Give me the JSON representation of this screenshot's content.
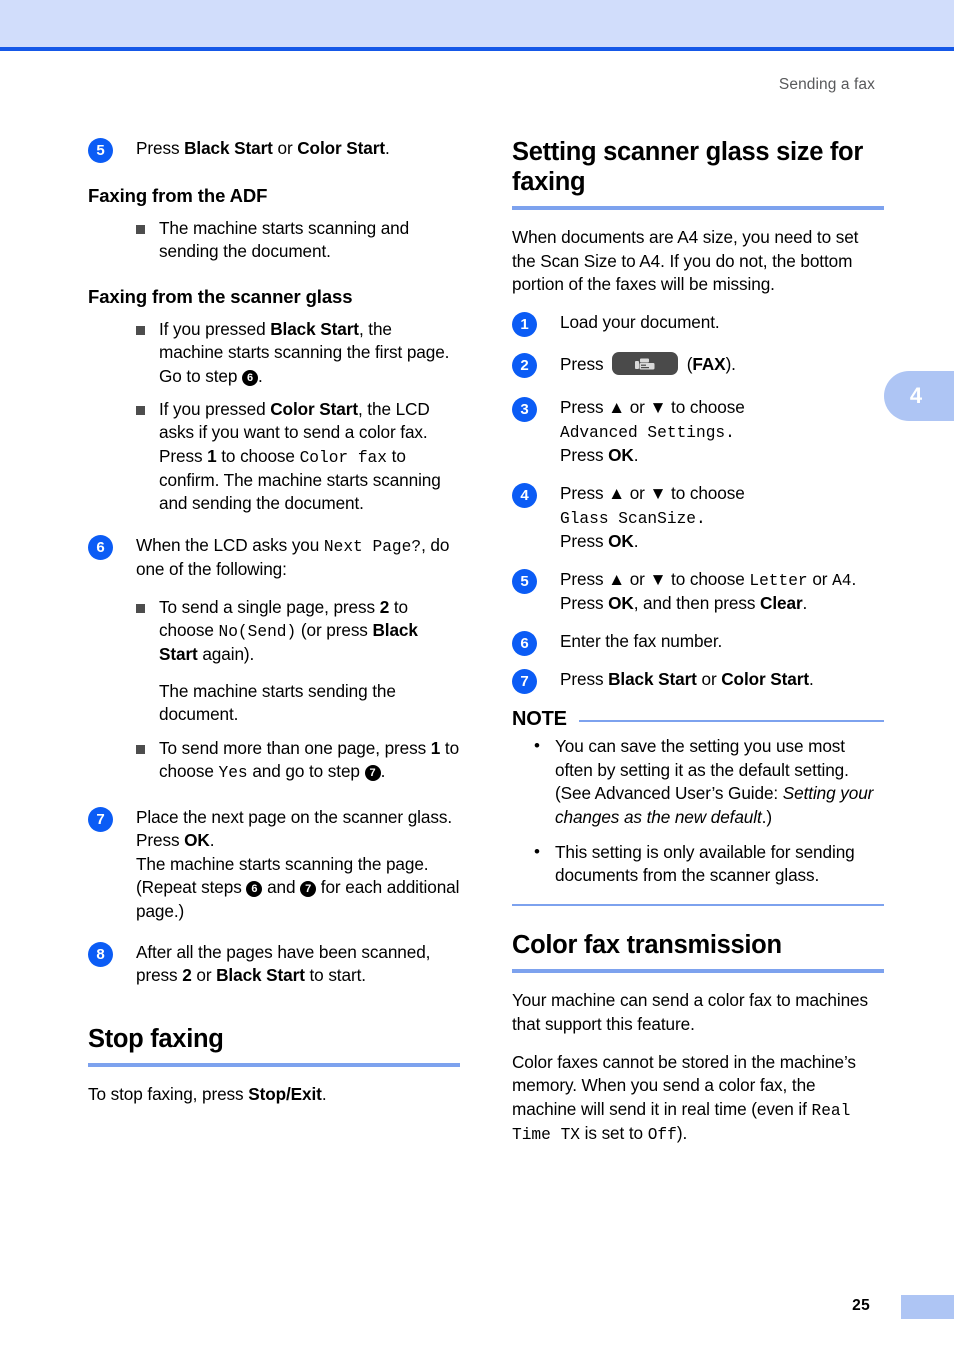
{
  "page": {
    "running_head": "Sending a fax",
    "chapter_tab": "4",
    "page_number": "25"
  },
  "left_column": {
    "step5": {
      "num": "5",
      "text_pre": "Press ",
      "bold1": "Black Start",
      "mid": " or ",
      "bold2": "Color Start",
      "text_post": "."
    },
    "adf_heading": "Faxing from the ADF",
    "adf_bullets": [
      "The machine starts scanning and sending the document."
    ],
    "glass_heading": "Faxing from the scanner glass",
    "glass_bullet1": {
      "a": "If you pressed ",
      "bold": "Black Start",
      "b": ", the machine starts scanning the first page. Go to step ",
      "ref": "6",
      "c": "."
    },
    "glass_bullet2": {
      "a": "If you pressed ",
      "bold": "Color Start",
      "b": ", the LCD asks if you want to send a color fax. Press ",
      "bold2": "1",
      "c": " to choose ",
      "lcd": "Color fax",
      "d": " to confirm. The machine starts scanning and sending the document."
    },
    "step6": {
      "num": "6",
      "a": "When the LCD asks you ",
      "lcd": "Next Page?",
      "b": ", do one of the following:",
      "bullet1": {
        "a": "To send a single page, press ",
        "bold": "2",
        "b": " to choose ",
        "lcd": "No(Send)",
        "c": " (or press ",
        "bold2": "Black Start",
        "d": " again)."
      },
      "sub_para": "The machine starts sending the document.",
      "bullet2": {
        "a": "To send more than one page, press ",
        "bold": "1",
        "b": " to choose ",
        "lcd": "Yes",
        "c": " and go to step ",
        "ref": "7",
        "d": "."
      }
    },
    "step7": {
      "num": "7",
      "a": "Place the next page on the scanner glass.",
      "b": "Press ",
      "bold_ok": "OK",
      "c": ".",
      "d": "The machine starts scanning the page.",
      "e": "(Repeat steps ",
      "ref1": "6",
      "f": " and ",
      "ref2": "7",
      "g": " for each additional page.)"
    },
    "step8": {
      "num": "8",
      "a": "After all the pages have been scanned, press ",
      "bold1": "2",
      "b": " or ",
      "bold2": "Black Start",
      "c": " to start."
    },
    "stop_heading": "Stop faxing",
    "stop_body": {
      "a": "To stop faxing, press ",
      "bold": "Stop/Exit",
      "b": "."
    }
  },
  "right_column": {
    "heading1": "Setting scanner glass size for faxing",
    "intro": "When documents are A4 size, you need to set the Scan Size to A4. If you do not, the bottom portion of the faxes will be missing.",
    "step1": {
      "num": "1",
      "text": "Load your document."
    },
    "step2": {
      "num": "2",
      "a": "Press ",
      "button_icon": "fax-machine-icon",
      "b": " (",
      "bold": "FAX",
      "c": ")."
    },
    "step3": {
      "num": "3",
      "a": "Press ▲ or ▼ to choose",
      "lcd": "Advanced Settings.",
      "b": "Press ",
      "bold_ok": "OK",
      "c": "."
    },
    "step4": {
      "num": "4",
      "a": "Press ▲ or ▼ to choose",
      "lcd": "Glass ScanSize.",
      "b": "Press ",
      "bold_ok": "OK",
      "c": "."
    },
    "step5": {
      "num": "5",
      "a": "Press ▲ or ▼ to choose ",
      "lcd1": "Letter",
      "b": " or ",
      "lcd2": "A4",
      "c": ".",
      "d": "Press ",
      "bold_ok": "OK",
      "e": ", and then press ",
      "bold_clear": "Clear",
      "f": "."
    },
    "step6": {
      "num": "6",
      "text": "Enter the fax number."
    },
    "step7": {
      "num": "7",
      "a": "Press ",
      "bold1": "Black Start",
      "b": " or ",
      "bold2": "Color Start",
      "c": "."
    },
    "note": {
      "title": "NOTE",
      "item1": {
        "a": "You can save the setting you use most often by setting it as the default setting. (See Advanced User’s Guide: ",
        "italic": "Setting your changes as the new default",
        "b": ".)"
      },
      "item2": "This setting is only available for sending documents from the scanner glass."
    },
    "heading2": "Color fax transmission",
    "para1": "Your machine can send a color fax to machines that support this feature.",
    "para2": {
      "a": "Color faxes cannot be stored in the machine’s memory. When you send a color fax, the machine will send it in real time (even if ",
      "lcd1": "Real Time TX",
      "b": " is set to ",
      "lcd2": "Off",
      "c": ")."
    }
  },
  "colors": {
    "band": "#d1ddfb",
    "rule": "#1558e8",
    "heading_rule": "#7da2ee",
    "step_circle": "#0b5cf5",
    "tab": "#aec5f4"
  }
}
